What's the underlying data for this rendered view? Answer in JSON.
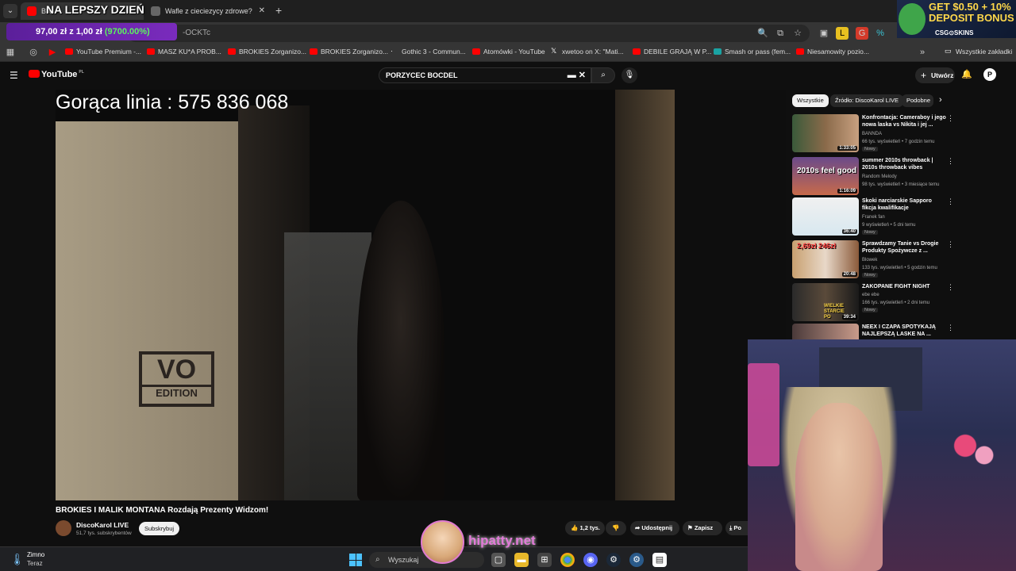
{
  "overlay": {
    "stream_title": "NA LEPSZY DZIEŃ",
    "bet_amount": "97,00 zł z 1,00 zł",
    "bet_pct": "(9700.00%)",
    "ad_line1": "GET $0.50 + 10%",
    "ad_line2": "DEPOSIT BONUS",
    "ad_brand": "CSG⊙SKINS",
    "hotline": "Gorąca linia : 575 836 068",
    "watermark": "hipatty.net"
  },
  "browser": {
    "tabs": [
      {
        "label": "BR"
      },
      {
        "label": "Wafle z cieciezycy zdrowe?"
      }
    ],
    "url_fragment": "-OCKTc",
    "bookmarks": [
      "YouTube Premium -...",
      "MASZ KU*A PROB...",
      "BROKIES Zorganizo...",
      "BROKIES Zorganizo...",
      "Gothic 3 - Commun...",
      "Atomówki - YouTube",
      "xwetoo on X: \"Mati...",
      "DEBILE GRAJĄ W P...",
      "Smash or pass (fem...",
      "Niesamowity pozio..."
    ],
    "all_bookmarks": "Wszystkie zakładki"
  },
  "youtube": {
    "logo": "YouTube",
    "logo_country": "PL",
    "search_query": "PORZYCEC BOCDEL",
    "create_label": "Utwórz",
    "avatar_letter": "P",
    "video": {
      "title": "BROKIES I MALIK MONTANA Rozdają Prezenty Widzom!",
      "vo_top": "VO",
      "vo_bottom": "EDITION",
      "channel": "DiscoKarol LIVE",
      "subscribers": "51,7 tys. subskrybentów",
      "subscribe": "Subskrybuj",
      "likes": "1,2 tys.",
      "share": "Udostępnij",
      "save": "Zapisz",
      "more": "Po"
    },
    "chips": [
      "Wszystkie",
      "Źródło: DiscoKarol LIVE",
      "Podobne"
    ],
    "recommendations": [
      {
        "title": "Konfrontacja: Cameraboy i jego nowa laska vs Nikita i jej ...",
        "channel": "BANNDA",
        "meta": "66 tys. wyświetleń • 7 godzin temu",
        "badge": "Nowy",
        "duration": "1:33:05"
      },
      {
        "title": "summer 2010s throwback | 2010s throwback vibes",
        "channel": "Random Melody",
        "meta": "98 tys. wyświetleń • 3 miesiące temu",
        "badge": "",
        "duration": "1:16:09",
        "thumb_text": "2010s feel good"
      },
      {
        "title": "Skoki narciarskie Sapporo fikcja kwalifikacje",
        "channel": "Franek fan",
        "meta": "9 wyświetleń • 5 dni temu",
        "badge": "Nowy",
        "duration": "36:40"
      },
      {
        "title": "Sprawdzamy Tanie vs Drogie Produkty Spożywcze z ...",
        "channel": "Blowek",
        "meta": "133 tys. wyświetleń • 5 godzin temu",
        "badge": "Nowy",
        "duration": "20:48",
        "thumb_text": "2,69zł 246zł"
      },
      {
        "title": "ZAKOPANE FIGHT NIGHT",
        "channel": "ebe ebe",
        "meta": "166 tys. wyświetleń • 2 dni temu",
        "badge": "Nowy",
        "duration": "39:34",
        "thumb_text": "WIELKIE STARCIE PO"
      },
      {
        "title": "NEEX I CZAPA SPOTYKAJĄ NAJLEPSZĄ LASKE NA ...",
        "channel": "",
        "meta": "",
        "badge": "",
        "duration": ""
      }
    ]
  },
  "taskbar": {
    "weather": "Zimno",
    "weather_sub": "Teraz",
    "search": "Wyszukaj"
  }
}
